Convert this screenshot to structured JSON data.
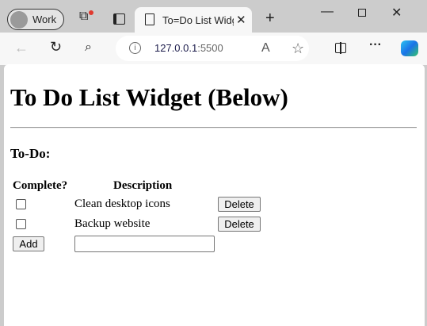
{
  "browser": {
    "profile_label": "Work",
    "tab_title": "To=Do List Widget (Below)",
    "url_host": "127.0.0.1",
    "url_port": ":5500",
    "accent_color": "#1a73e8"
  },
  "page": {
    "heading": "To Do List Widget (Below)",
    "section_title": "To-Do:",
    "columns": [
      "Complete?",
      "Description"
    ],
    "items": [
      {
        "description": "Clean desktop icons",
        "complete": false,
        "delete_label": "Delete"
      },
      {
        "description": "Backup website",
        "complete": false,
        "delete_label": "Delete"
      }
    ],
    "add_label": "Add",
    "new_item_value": ""
  }
}
